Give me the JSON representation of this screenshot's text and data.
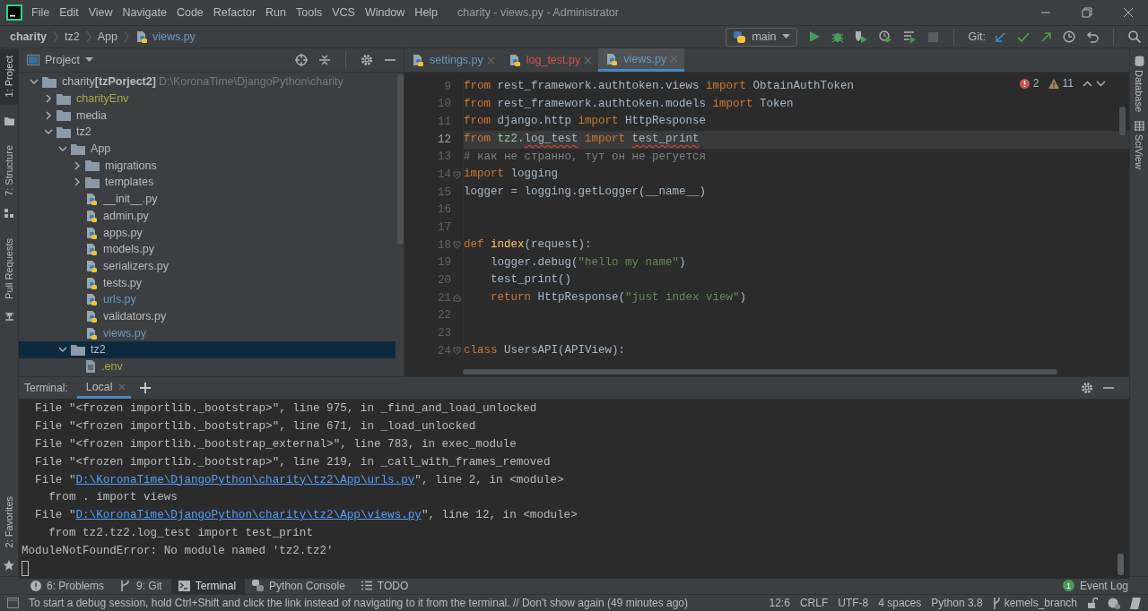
{
  "window": {
    "title": "charity - views.py - Administrator",
    "menu": [
      "File",
      "Edit",
      "View",
      "Navigate",
      "Code",
      "Refactor",
      "Run",
      "Tools",
      "VCS",
      "Window",
      "Help"
    ]
  },
  "breadcrumbs": [
    {
      "label": "charity",
      "kind": "root"
    },
    {
      "label": "tz2",
      "kind": "folder"
    },
    {
      "label": "App",
      "kind": "folder"
    },
    {
      "label": "views.py",
      "kind": "python"
    }
  ],
  "run_config": {
    "label": "main"
  },
  "git": {
    "label": "Git:"
  },
  "left_tabs": [
    {
      "label": "1: Project",
      "selected": true,
      "kind": "project"
    },
    {
      "label": "7: Structure",
      "selected": false,
      "kind": "structure"
    },
    {
      "label": "Pull Requests",
      "selected": false,
      "kind": "pull_requests"
    },
    {
      "label": "2: Favorites",
      "selected": false,
      "kind": "favorites"
    }
  ],
  "right_tabs": [
    {
      "label": "Database",
      "kind": "database"
    },
    {
      "label": "SciView",
      "kind": "sciview"
    }
  ],
  "project": {
    "title": "Project",
    "tree": [
      {
        "name": "charity",
        "module": "[tzPorject2]",
        "path": "D:\\KoronaTime\\DjangoPython\\charity",
        "kind": "folder",
        "expanded": true,
        "selected": false,
        "children": [
          {
            "name": "charityEnv",
            "kind": "folder",
            "expanded": false,
            "selected": false,
            "color": "#a8a84a"
          },
          {
            "name": "media",
            "kind": "folder",
            "expanded": false,
            "selected": false
          },
          {
            "name": "tz2",
            "kind": "folder",
            "expanded": true,
            "selected": false,
            "children": [
              {
                "name": "App",
                "kind": "folder",
                "expanded": true,
                "selected": false,
                "children": [
                  {
                    "name": "migrations",
                    "kind": "folder",
                    "expanded": false,
                    "selected": false
                  },
                  {
                    "name": "templates",
                    "kind": "folder",
                    "expanded": false,
                    "selected": false
                  },
                  {
                    "name": "__init__.py",
                    "kind": "python",
                    "selected": false
                  },
                  {
                    "name": "admin.py",
                    "kind": "python",
                    "selected": false
                  },
                  {
                    "name": "apps.py",
                    "kind": "python",
                    "selected": false
                  },
                  {
                    "name": "models.py",
                    "kind": "python",
                    "selected": false
                  },
                  {
                    "name": "serializers.py",
                    "kind": "python",
                    "selected": false
                  },
                  {
                    "name": "tests.py",
                    "kind": "python",
                    "selected": false
                  },
                  {
                    "name": "urls.py",
                    "kind": "python",
                    "selected": false,
                    "color": "#6897bb"
                  },
                  {
                    "name": "validators.py",
                    "kind": "python",
                    "selected": false
                  },
                  {
                    "name": "views.py",
                    "kind": "python",
                    "selected": false,
                    "color": "#6897bb"
                  }
                ]
              },
              {
                "name": "tz2",
                "kind": "folder",
                "expanded": true,
                "selected": true,
                "children": [
                  {
                    "name": ".env",
                    "kind": "file",
                    "selected": false,
                    "color": "#a8a84a"
                  }
                ]
              }
            ]
          }
        ]
      }
    ]
  },
  "editor": {
    "tabs": [
      {
        "label": "settings.py",
        "selected": false,
        "color": "#6897bb"
      },
      {
        "label": "log_test.py",
        "selected": false,
        "color": "#d25252"
      },
      {
        "label": "views.py",
        "selected": true,
        "color": "#6897bb"
      }
    ],
    "errors": "2",
    "warnings": "11",
    "lines": [
      {
        "n": "9",
        "current": false,
        "fold_start": false,
        "fold_end": false,
        "tokens": [
          {
            "kind": "keyword",
            "text": "from"
          },
          {
            "kind": "plain",
            "text": " rest_framework.authtoken.views "
          },
          {
            "kind": "keyword",
            "text": "import"
          },
          {
            "kind": "plain",
            "text": " ObtainAuthToken"
          }
        ]
      },
      {
        "n": "10",
        "current": false,
        "fold_start": false,
        "fold_end": false,
        "tokens": [
          {
            "kind": "keyword",
            "text": "from"
          },
          {
            "kind": "plain",
            "text": " rest_framework.authtoken.models "
          },
          {
            "kind": "keyword",
            "text": "import"
          },
          {
            "kind": "plain",
            "text": " Token"
          }
        ]
      },
      {
        "n": "11",
        "current": false,
        "fold_start": false,
        "fold_end": false,
        "tokens": [
          {
            "kind": "keyword",
            "text": "from"
          },
          {
            "kind": "plain",
            "text": " django.http "
          },
          {
            "kind": "keyword",
            "text": "import"
          },
          {
            "kind": "plain",
            "text": " HttpResponse"
          }
        ]
      },
      {
        "n": "12",
        "current": true,
        "fold_start": false,
        "fold_end": false,
        "tokens": [
          {
            "kind": "keyword",
            "text": "from "
          },
          {
            "kind": "highlight",
            "text": "tz2"
          },
          {
            "kind": "plain",
            "text": "."
          },
          {
            "kind": "unresolved",
            "text": "log_test"
          },
          {
            "kind": "keyword",
            "text": " import "
          },
          {
            "kind": "unresolved",
            "text": "test_print"
          }
        ]
      },
      {
        "n": "13",
        "current": false,
        "fold_start": false,
        "fold_end": false,
        "tokens": [
          {
            "kind": "comment",
            "text": "# как не странно, тут он не регуется"
          }
        ]
      },
      {
        "n": "14",
        "current": false,
        "fold_start": true,
        "fold_end": false,
        "tokens": [
          {
            "kind": "keyword",
            "text": "import"
          },
          {
            "kind": "plain",
            "text": " logging"
          }
        ]
      },
      {
        "n": "15",
        "current": false,
        "fold_start": false,
        "fold_end": false,
        "tokens": [
          {
            "kind": "plain",
            "text": "logger = logging.getLogger(__name__)"
          }
        ]
      },
      {
        "n": "16",
        "current": false,
        "fold_start": false,
        "fold_end": false
      },
      {
        "n": "17",
        "current": false,
        "fold_start": false,
        "fold_end": false
      },
      {
        "n": "18",
        "current": false,
        "fold_start": true,
        "fold_end": false,
        "tokens": [
          {
            "kind": "keyword",
            "text": "def "
          },
          {
            "kind": "function",
            "text": "index"
          },
          {
            "kind": "plain",
            "text": "(request):"
          }
        ]
      },
      {
        "n": "19",
        "current": false,
        "fold_start": false,
        "fold_end": false,
        "tokens": [
          {
            "kind": "plain",
            "text": "    logger.debug("
          },
          {
            "kind": "string",
            "text": "\"hello my name\""
          },
          {
            "kind": "plain",
            "text": ")"
          }
        ]
      },
      {
        "n": "20",
        "current": false,
        "fold_start": false,
        "fold_end": false,
        "tokens": [
          {
            "kind": "plain",
            "text": "    test_print()"
          }
        ]
      },
      {
        "n": "21",
        "current": false,
        "fold_start": false,
        "fold_end": true,
        "tokens": [
          {
            "kind": "keyword",
            "text": "    return"
          },
          {
            "kind": "plain",
            "text": " HttpResponse("
          },
          {
            "kind": "string",
            "text": "\"just index view\""
          },
          {
            "kind": "plain",
            "text": ")"
          }
        ]
      },
      {
        "n": "22",
        "current": false,
        "fold_start": false,
        "fold_end": false
      },
      {
        "n": "23",
        "current": false,
        "fold_start": false,
        "fold_end": false
      },
      {
        "n": "24",
        "current": false,
        "fold_start": true,
        "fold_end": false,
        "tokens": [
          {
            "kind": "keyword",
            "text": "class"
          },
          {
            "kind": "plain",
            "text": " UsersAPI(APIView):"
          }
        ]
      }
    ]
  },
  "terminal": {
    "label": "Terminal:",
    "tabs": [
      {
        "label": "Local",
        "selected": true
      }
    ],
    "lines": [
      [
        {
          "kind": "plain",
          "text": "  File \"<frozen importlib._bootstrap>\", line 975, in _find_and_load_unlocked"
        }
      ],
      [
        {
          "kind": "plain",
          "text": "  File \"<frozen importlib._bootstrap>\", line 671, in _load_unlocked"
        }
      ],
      [
        {
          "kind": "plain",
          "text": "  File \"<frozen importlib._bootstrap_external>\", line 783, in exec_module"
        }
      ],
      [
        {
          "kind": "plain",
          "text": "  File \"<frozen importlib._bootstrap>\", line 219, in _call_with_frames_removed"
        }
      ],
      [
        {
          "kind": "plain",
          "text": "  File \""
        },
        {
          "kind": "link",
          "text": "D:\\KoronaTime\\DjangoPython\\charity\\tz2\\App\\urls.py"
        },
        {
          "kind": "plain",
          "text": "\", line 2, in <module>"
        }
      ],
      [
        {
          "kind": "plain",
          "text": "    from . import views"
        }
      ],
      [
        {
          "kind": "plain",
          "text": "  File \""
        },
        {
          "kind": "link",
          "text": "D:\\KoronaTime\\DjangoPython\\charity\\tz2\\App\\views.py"
        },
        {
          "kind": "plain",
          "text": "\", line 12, in <module>"
        }
      ],
      [
        {
          "kind": "plain",
          "text": "    from tz2.tz2.log_test import test_print"
        }
      ],
      [
        {
          "kind": "plain",
          "text": "ModuleNotFoundError: No module named 'tz2.tz2'"
        }
      ]
    ]
  },
  "tool_windows": [
    {
      "label": "6: Problems",
      "kind": "problems",
      "selected": false
    },
    {
      "label": "9: Git",
      "kind": "git",
      "selected": false
    },
    {
      "label": "Terminal",
      "kind": "terminal",
      "selected": true
    },
    {
      "label": "Python Console",
      "kind": "python",
      "selected": false
    },
    {
      "label": "TODO",
      "kind": "todo",
      "selected": false
    }
  ],
  "event_log": {
    "label": "Event Log",
    "count": "1"
  },
  "status_bar": {
    "message": "To start a debug session, hold Ctrl+Shift and click the link instead of navigating to it from the terminal. // Don't show again (49 minutes ago)",
    "items": [
      {
        "label": "12:6",
        "kind": "text"
      },
      {
        "label": "CRLF",
        "kind": "text"
      },
      {
        "label": "UTF-8",
        "kind": "text"
      },
      {
        "label": "4 spaces",
        "kind": "text"
      },
      {
        "label": "Python 3.8",
        "kind": "text"
      },
      {
        "label": "kemels_branch",
        "kind": "branch"
      }
    ]
  }
}
